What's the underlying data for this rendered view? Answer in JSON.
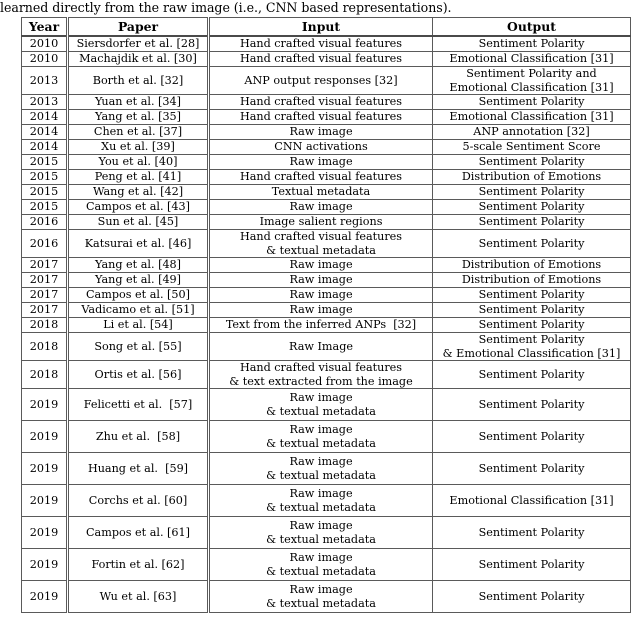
{
  "caption": "learned directly from the raw image (i.e., CNN based representations).",
  "table": {
    "headers": [
      "Year",
      "Paper",
      "Input",
      "Output"
    ],
    "rows": [
      {
        "year": "2010",
        "paper": "Siersdorfer et al. [28]",
        "input": "Hand crafted visual features",
        "output": "Sentiment Polarity",
        "lines": 1
      },
      {
        "year": "2010",
        "paper": "Machajdik et al. [30]",
        "input": "Hand crafted visual features",
        "output": "Emotional Classification [31]",
        "lines": 1
      },
      {
        "year": "2013",
        "paper": "Borth et al. [32]",
        "input": "ANP output responses [32]",
        "output": "Sentiment Polarity and\nEmotional Classification [31]",
        "lines": 2
      },
      {
        "year": "2013",
        "paper": "Yuan et al. [34]",
        "input": "Hand crafted visual features",
        "output": "Sentiment Polarity",
        "lines": 1
      },
      {
        "year": "2014",
        "paper": "Yang et al. [35]",
        "input": "Hand crafted visual features",
        "output": "Emotional Classification [31]",
        "lines": 1
      },
      {
        "year": "2014",
        "paper": "Chen et al. [37]",
        "input": "Raw image",
        "output": "ANP annotation [32]",
        "lines": 1
      },
      {
        "year": "2014",
        "paper": "Xu et al. [39]",
        "input": "CNN activations",
        "output": "5-scale Sentiment Score",
        "lines": 1
      },
      {
        "year": "2015",
        "paper": "You et al. [40]",
        "input": "Raw image",
        "output": "Sentiment Polarity",
        "lines": 1
      },
      {
        "year": "2015",
        "paper": "Peng et al. [41]",
        "input": "Hand crafted visual features",
        "output": "Distribution of Emotions",
        "lines": 1
      },
      {
        "year": "2015",
        "paper": "Wang et al. [42]",
        "input": "Textual metadata",
        "output": "Sentiment Polarity",
        "lines": 1
      },
      {
        "year": "2015",
        "paper": "Campos et al. [43]",
        "input": "Raw image",
        "output": "Sentiment Polarity",
        "lines": 1
      },
      {
        "year": "2016",
        "paper": "Sun et al. [45]",
        "input": "Image salient regions",
        "output": "Sentiment Polarity",
        "lines": 1
      },
      {
        "year": "2016",
        "paper": "Katsurai et al. [46]",
        "input": "Hand crafted visual features\n& textual metadata",
        "output": "Sentiment Polarity",
        "lines": 2
      },
      {
        "year": "2017",
        "paper": "Yang et al. [48]",
        "input": "Raw image",
        "output": "Distribution of Emotions",
        "lines": 1
      },
      {
        "year": "2017",
        "paper": "Yang et al. [49]",
        "input": "Raw image",
        "output": "Distribution of Emotions",
        "lines": 1
      },
      {
        "year": "2017",
        "paper": "Campos et al. [50]",
        "input": "Raw image",
        "output": "Sentiment Polarity",
        "lines": 1
      },
      {
        "year": "2017",
        "paper": "Vadicamo et al. [51]",
        "input": "Raw image",
        "output": "Sentiment Polarity",
        "lines": 1
      },
      {
        "year": "2018",
        "paper": "Li et al. [54]",
        "input": "Text from the inferred ANPs  [32]",
        "output": "Sentiment Polarity",
        "lines": 1
      },
      {
        "year": "2018",
        "paper": "Song et al. [55]",
        "input": "Raw Image",
        "output": "Sentiment Polarity\n& Emotional Classification [31]",
        "lines": 2
      },
      {
        "year": "2018",
        "paper": "Ortis et al. [56]",
        "input": "Hand crafted visual features\n& text extracted from the image",
        "output": "Sentiment Polarity",
        "lines": 2
      },
      {
        "year": "2019",
        "paper": "Felicetti et al.  [57]",
        "input": "Raw image\n& textual metadata",
        "output": "Sentiment Polarity",
        "lines": 2
      },
      {
        "year": "2019",
        "paper": "Zhu et al.  [58]",
        "input": "Raw image\n& textual metadata",
        "output": "Sentiment Polarity",
        "lines": 2
      },
      {
        "year": "2019",
        "paper": "Huang et al.  [59]",
        "input": "Raw image\n& textual metadata",
        "output": "Sentiment Polarity",
        "lines": 2
      },
      {
        "year": "2019",
        "paper": "Corchs et al. [60]",
        "input": "Raw image\n& textual metadata",
        "output": "Emotional Classification [31]",
        "lines": 2
      },
      {
        "year": "2019",
        "paper": "Campos et al. [61]",
        "input": "Raw image\n& textual metadata",
        "output": "Sentiment Polarity",
        "lines": 2
      },
      {
        "year": "2019",
        "paper": "Fortin et al. [62]",
        "input": "Raw image\n& textual metadata",
        "output": "Sentiment Polarity",
        "lines": 2
      },
      {
        "year": "2019",
        "paper": "Wu et al. [63]",
        "input": "Raw image\n& textual metadata",
        "output": "Sentiment Polarity",
        "lines": 2
      }
    ]
  }
}
